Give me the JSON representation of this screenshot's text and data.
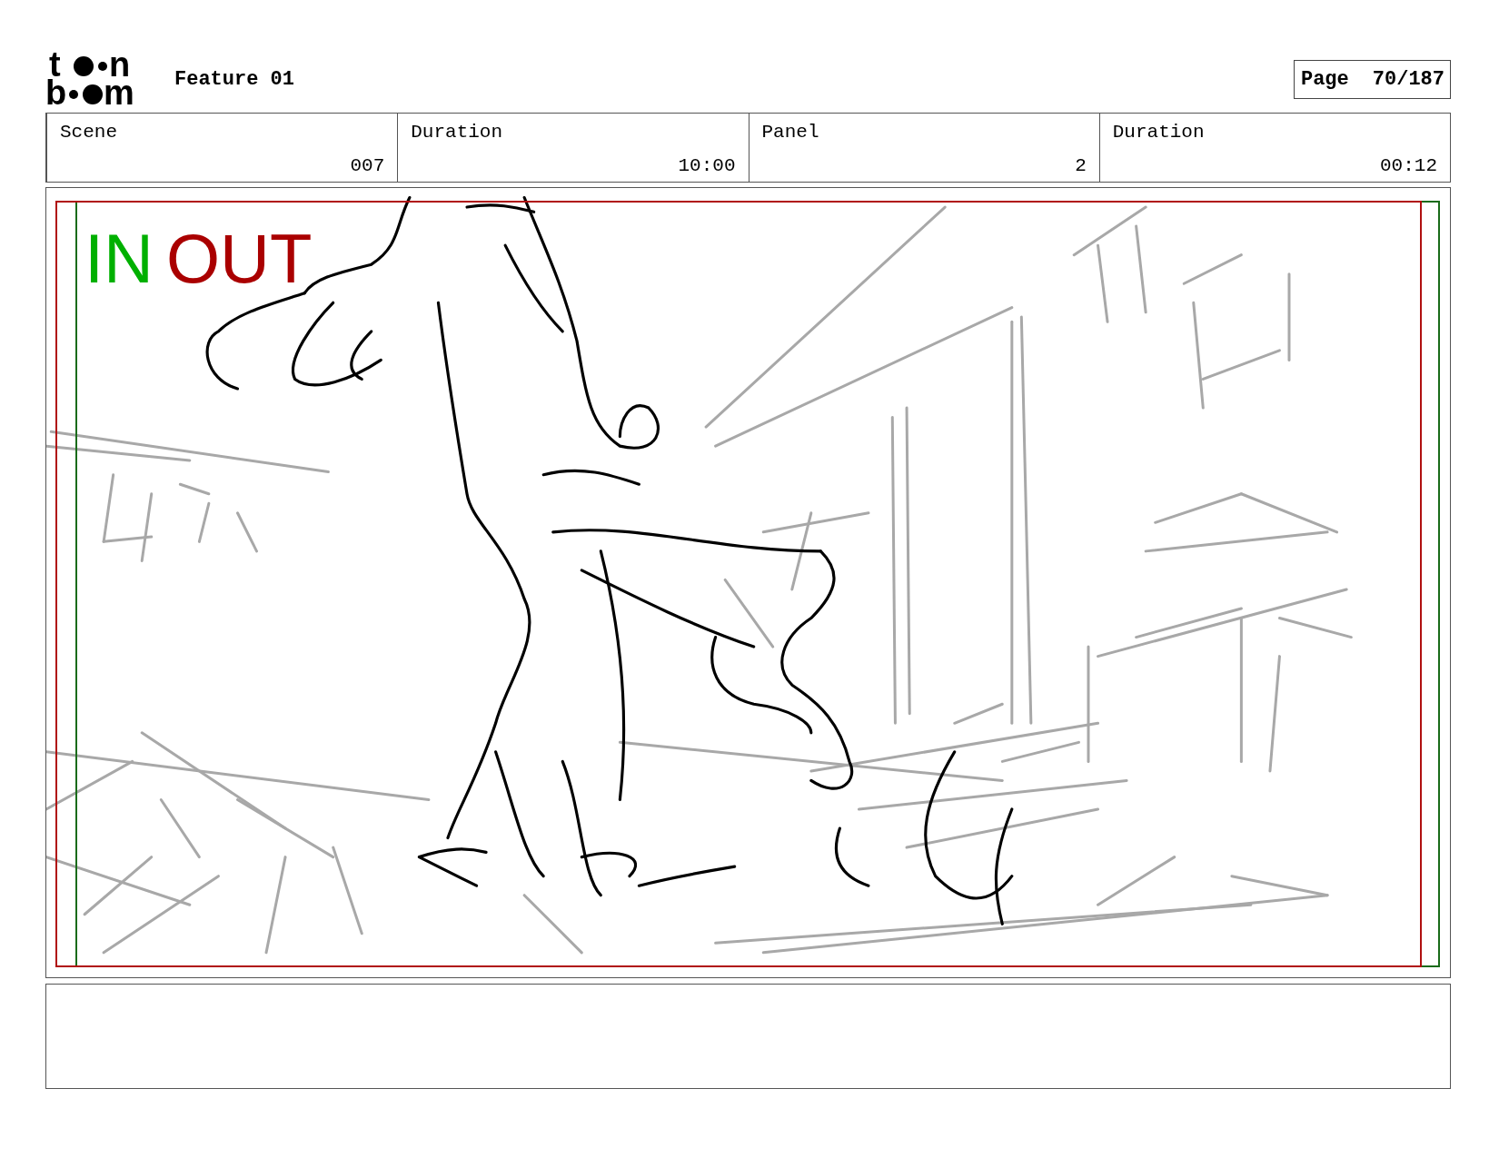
{
  "logo": {
    "top_left": "t",
    "top_right": "n",
    "bottom_left": "b",
    "bottom_right": "m"
  },
  "project_title": "Feature 01",
  "page": {
    "label": "Page",
    "number": "70/187"
  },
  "info": [
    {
      "label": "Scene",
      "value": "007"
    },
    {
      "label": "Duration",
      "value": "10:00"
    },
    {
      "label": "Panel",
      "value": "2"
    },
    {
      "label": "Duration",
      "value": "00:12"
    }
  ],
  "panel": {
    "markers": [
      {
        "kind": "in",
        "text": "IN"
      },
      {
        "kind": "out",
        "text": "OUT"
      }
    ]
  }
}
